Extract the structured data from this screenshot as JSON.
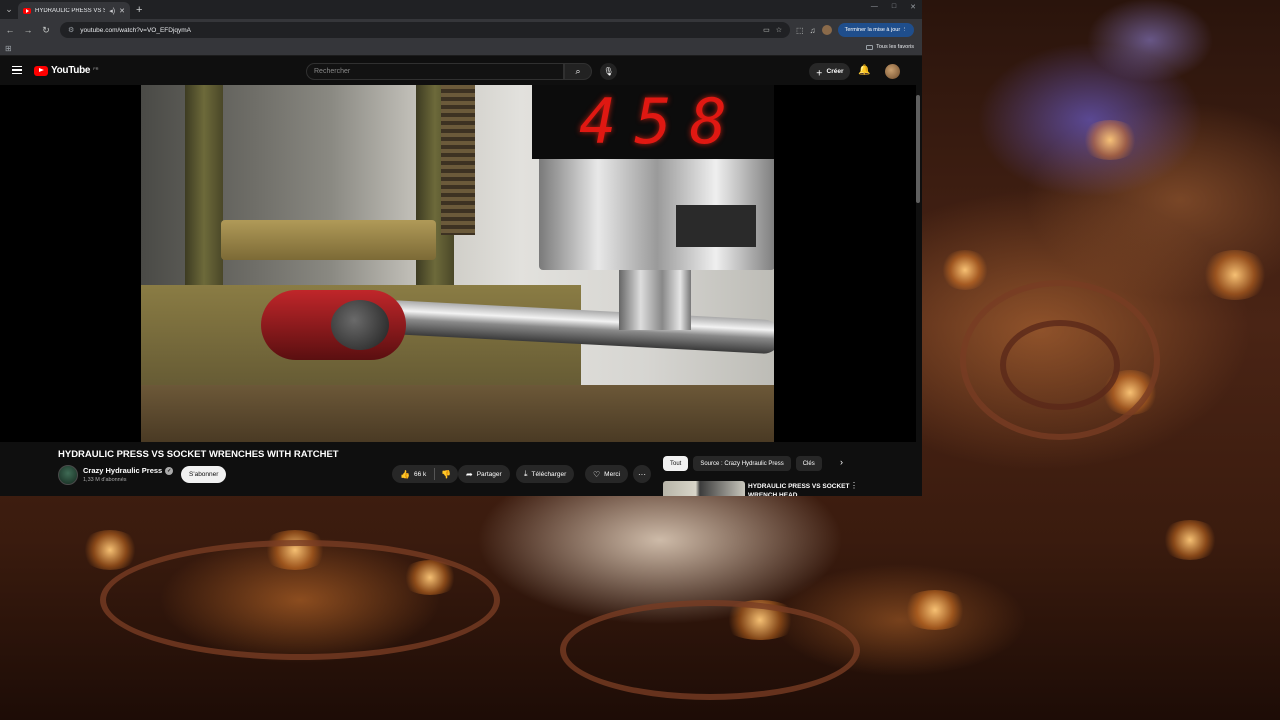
{
  "browser": {
    "tab_title": "HYDRAULIC PRESS VS SOCKET WRENCHES WITH RATCHET - YouTube",
    "url": "youtube.com/watch?v=VO_EFDjqymA",
    "update_button": "Terminer la mise à jour",
    "all_bookmarks": "Tous les favoris"
  },
  "youtube": {
    "logo_text": "YouTube",
    "logo_country": "FR",
    "search_placeholder": "Rechercher",
    "create_label": "Créer"
  },
  "video": {
    "display_value": "458",
    "title": "HYDRAULIC PRESS VS SOCKET WRENCHES WITH RATCHET",
    "channel_name": "Crazy Hydraulic Press",
    "subscribers": "1,33 M d'abonnés",
    "subscribe_label": "S'abonner",
    "like_count": "66 k",
    "share_label": "Partager",
    "download_label": "Télécharger",
    "thanks_label": "Merci"
  },
  "sidebar": {
    "chips": [
      "Tout",
      "Source : Crazy Hydraulic Press",
      "Clés"
    ],
    "recommendation_title": "HYDRAULIC PRESS VS SOCKET WRENCH HEAD"
  },
  "colors": {
    "youtube_red": "#ff0000",
    "display_red": "#e01812",
    "update_blue": "#1f4e8c"
  }
}
